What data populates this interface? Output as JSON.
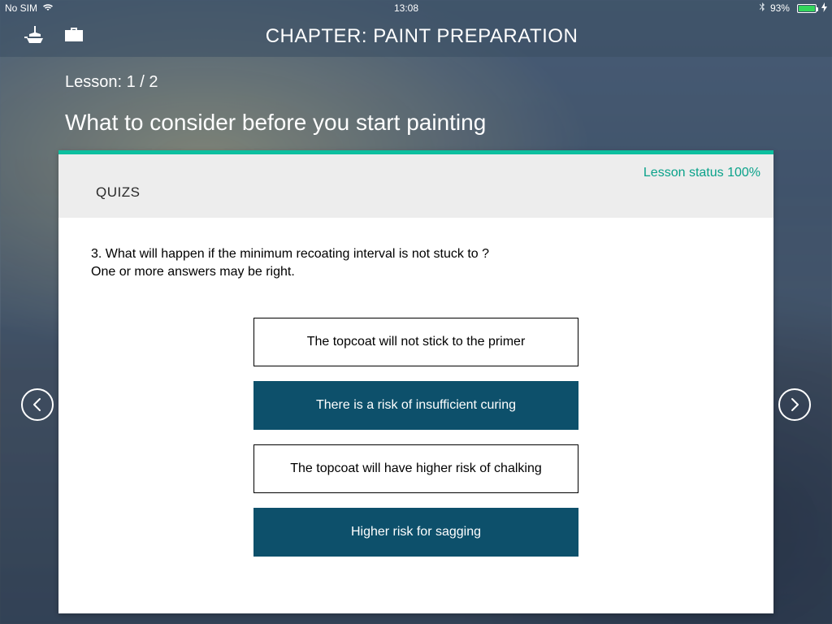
{
  "status_bar": {
    "carrier": "No SIM",
    "time": "13:08",
    "battery_percent": "93%"
  },
  "header": {
    "title": "CHAPTER: PAINT PREPARATION"
  },
  "lesson": {
    "counter": "Lesson: 1 / 2",
    "title": "What to consider before you start painting"
  },
  "card": {
    "section_label": "QUIZS",
    "status": "Lesson status 100%"
  },
  "question": {
    "line1": "3. What will happen if the minimum recoating interval is not stuck to ?",
    "line2": "One or more answers may be right."
  },
  "options": [
    {
      "text": "The topcoat will not stick to the primer",
      "selected": false
    },
    {
      "text": "There is a risk of insufficient curing",
      "selected": true
    },
    {
      "text": "The topcoat will have higher risk of chalking",
      "selected": false
    },
    {
      "text": "Higher risk for sagging",
      "selected": true
    }
  ]
}
